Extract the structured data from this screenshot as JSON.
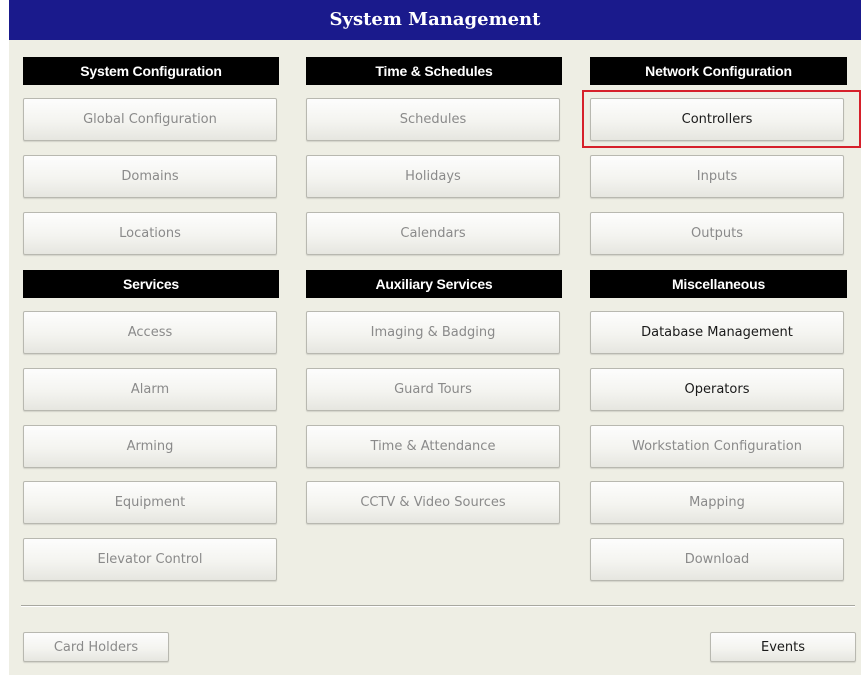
{
  "window": {
    "title": "System Management",
    "highlight_color": "#d6202a",
    "title_bar_color": "#1a1a8c"
  },
  "sections": {
    "system_configuration": {
      "header": "System Configuration",
      "buttons": [
        "Global Configuration",
        "Domains",
        "Locations"
      ]
    },
    "time_schedules": {
      "header": "Time & Schedules",
      "buttons": [
        "Schedules",
        "Holidays",
        "Calendars"
      ]
    },
    "network_configuration": {
      "header": "Network Configuration",
      "buttons": [
        "Controllers",
        "Inputs",
        "Outputs"
      ],
      "highlighted": "Controllers"
    },
    "services": {
      "header": "Services",
      "buttons": [
        "Access",
        "Alarm",
        "Arming",
        "Equipment",
        "Elevator Control"
      ]
    },
    "auxiliary_services": {
      "header": "Auxiliary Services",
      "buttons": [
        "Imaging & Badging",
        "Guard Tours",
        "Time & Attendance",
        "CCTV & Video Sources"
      ]
    },
    "miscellaneous": {
      "header": "Miscellaneous",
      "buttons": [
        "Database Management",
        "Operators",
        "Workstation Configuration",
        "Mapping",
        "Download"
      ]
    }
  },
  "footer": {
    "card_holders": "Card Holders",
    "events": "Events"
  }
}
